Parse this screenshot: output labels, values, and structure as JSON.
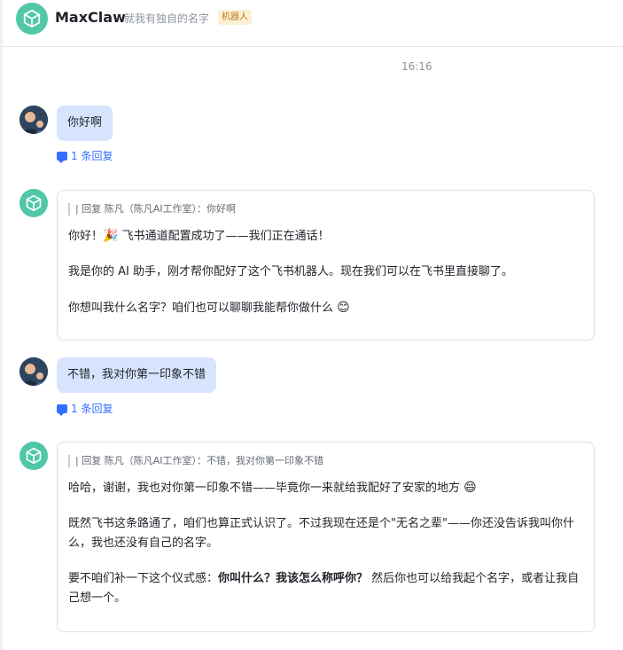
{
  "header": {
    "title": "MaxClaw",
    "subtitle": "就我有独自的名字",
    "badge": "机器人"
  },
  "timestamp": "16:16",
  "messages": [
    {
      "user_text": "你好啊",
      "reply_count": "1 条回复",
      "bot": {
        "quote": "| 回复 陈凡（陈凡AI工作室）：你好啊",
        "p1a": "你好！",
        "p1_emoji": "🎉",
        "p1b": " 飞书通道配置成功了——我们正在通话！",
        "p2": "我是你的 AI 助手，刚才帮你配好了这个飞书机器人。现在我们可以在飞书里直接聊了。",
        "p3": "你想叫我什么名字？咱们也可以聊聊我能帮你做什么",
        "p3_emoji": "😊"
      }
    },
    {
      "user_text": "不错，我对你第一印象不错",
      "reply_count": "1 条回复",
      "bot": {
        "quote": "| 回复 陈凡（陈凡AI工作室）：不错，我对你第一印象不错",
        "p1": "哈哈，谢谢，我也对你第一印象不错——毕竟你一来就给我配好了安家的地方",
        "p1_emoji": "😄",
        "p2": "既然飞书这条路通了，咱们也算正式认识了。不过我现在还是个\"无名之辈\"——你还没告诉我叫你什么，我也还没有自己的名字。",
        "p3a": "要不咱们补一下这个仪式感：",
        "p3_bold": "你叫什么？我该怎么称呼你？",
        "p3b": " 然后你也可以给我起个名字，或者让我自己想一个。"
      }
    }
  ],
  "colors": {
    "brand": "#4fc7a8",
    "user_bubble": "#d7e4fd",
    "link": "#3370ff"
  }
}
